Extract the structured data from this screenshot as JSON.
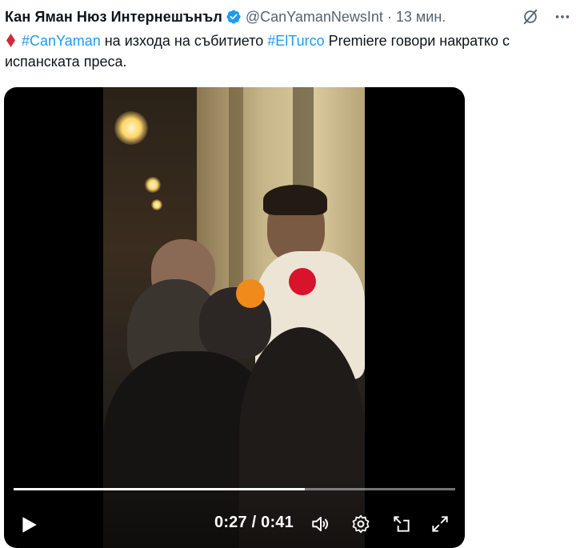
{
  "tweet": {
    "author_name": "Кан Яман Нюз Интернешънъл",
    "handle": "@CanYamanNewsInt",
    "separator": "·",
    "time": "13 мин.",
    "text_parts": {
      "hashtag1": "#CanYaman",
      "mid": " на изхода на събитието ",
      "hashtag2": "#ElTurco",
      "end": " Premiere говори накратко с испанската преса."
    },
    "colors": {
      "link": "#1d9bf0",
      "secondary": "#536471",
      "verified": "#1d9bf0",
      "diamond": "#d02a3a"
    }
  },
  "video": {
    "current_time": "0:27",
    "duration": "0:41",
    "time_separator": " / ",
    "progress_fraction": 0.659
  },
  "icons": [
    "verified-badge-icon",
    "grok-icon",
    "more-icon",
    "red-diamond-icon",
    "play-icon",
    "volume-icon",
    "settings-icon",
    "dock-icon",
    "fullscreen-icon"
  ]
}
